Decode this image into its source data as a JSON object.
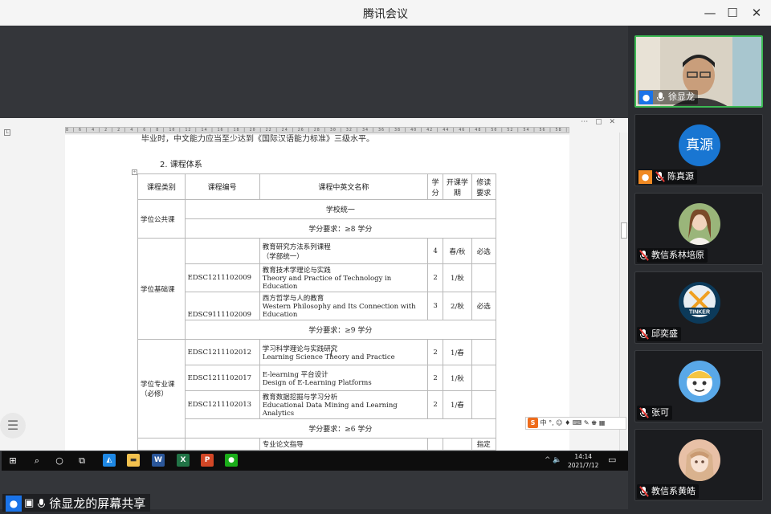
{
  "window": {
    "title": "腾讯会议",
    "minimize": "—",
    "maximize": "☐",
    "close": "✕"
  },
  "document": {
    "prev_line": "毕业时，中文能力应当至少达到《国际汉语能力标准》三级水平。",
    "section_heading": "2. 课程体系",
    "table_headers": [
      "课程类别",
      "课程编号",
      "课程中英文名称",
      "学分",
      "开课学期",
      "修读要求"
    ],
    "rows": {
      "gongong_cat": "学位公共课",
      "gongong_unified": "学校统一",
      "gongong_req": "学分要求：≥8 学分",
      "jichu_cat": "学位基础课",
      "r1": {
        "code": "",
        "cn": "教育研究方法系列课程",
        "en": "（学部统一）",
        "credit": "4",
        "term": "春/秋",
        "req": "必选"
      },
      "r2": {
        "code": "EDSC1211102009",
        "cn": "教育技术学理论与实践",
        "en": "Theory and Practice of Technology in Education",
        "credit": "2",
        "term": "1/秋",
        "req": ""
      },
      "r3": {
        "code": "EDSC9111102009",
        "cn": "西方哲学与人的教育",
        "en": "Western Philosophy and Its Connection with Education",
        "credit": "3",
        "term": "2/秋",
        "req": "必选"
      },
      "jichu_req": "学分要求：≥9 学分",
      "zhuanye_cat": "学位专业课（必修）",
      "r4": {
        "code": "EDSC1211102012",
        "cn": "学习科学理论与实践研究",
        "en": "Learning Science Theory and Practice",
        "credit": "2",
        "term": "1/春",
        "req": ""
      },
      "r5": {
        "code": "EDSC1211102017",
        "cn": "E-learning 平台设计",
        "en": "Design of E-Learning Platforms",
        "credit": "2",
        "term": "1/秋",
        "req": ""
      },
      "r6": {
        "code": "EDSC1211102013",
        "cn": "教育数据挖掘与学习分析",
        "en": "Educational Data Mining and Learning Analytics",
        "credit": "2",
        "term": "1/春",
        "req": ""
      },
      "zhuanye_req": "学分要求：≥6 学分",
      "r7": {
        "cn": "专业论文指导",
        "req": "指定"
      }
    }
  },
  "ime": {
    "logo": "S",
    "mode": "中",
    "extras": "°, ☺ ♦ ⌨ ✎ ♚ ▦"
  },
  "taskbar": {
    "time": "14:14",
    "date": "2021/7/12"
  },
  "share_caption": "徐显龙的屏幕共享",
  "participants": [
    {
      "name": "徐显龙",
      "mic": "on",
      "video": true,
      "badge": "blue"
    },
    {
      "name": "陈真源",
      "mic": "muted",
      "avatar_text": "真源",
      "badge": "orange",
      "color": "#1976d2"
    },
    {
      "name": "教信系林培原",
      "mic": "muted",
      "avatar_text": "",
      "color": "#9ab57a"
    },
    {
      "name": "邱奕盛",
      "mic": "muted",
      "avatar_text": "TINKER",
      "color": "#0c3a5a"
    },
    {
      "name": "张可",
      "mic": "muted",
      "avatar_text": "",
      "color": "#59a8e8"
    },
    {
      "name": "教信系黄皓",
      "mic": "muted",
      "avatar_text": "",
      "color": "#e8c0a6"
    }
  ]
}
